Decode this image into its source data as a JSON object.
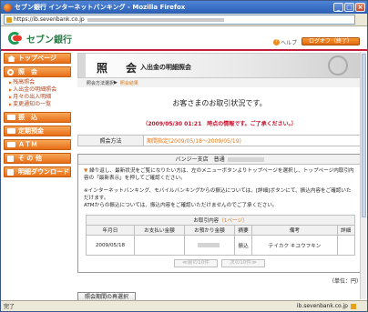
{
  "window": {
    "title": "セブン銀行 インターネットバンキング - Mozilla Firefox"
  },
  "urlbar": {
    "url": "https://ib.sevenbank.co.jp"
  },
  "header": {
    "logo_text": "セブン銀行",
    "help_label": "ヘルプ",
    "logout_label": "ログオフ（終了）"
  },
  "sidebar": {
    "top_label": "トップページ",
    "inquiry_label": "照　会",
    "sub_items": [
      "残高照会",
      "入出金の明細照会",
      "月々の出入明細",
      "変更通知の一覧"
    ],
    "transfer_label": "振　込",
    "fixed_label": "定期預金",
    "atm_label": "ＡＴＭ",
    "other_label": "そ の 他",
    "download_label": "明細ダウンロード"
  },
  "banner": {
    "title": "照　会",
    "subtitle": "入出金の明細照会"
  },
  "breadcrumb": {
    "prev": "照会方法選択",
    "current": "照会結果"
  },
  "greeting": "お客さまのお取引状況です。",
  "notice": "（2009/05/30 01:21　時点の情報です。ご了承ください。）",
  "query": {
    "method_key": "照会方法",
    "method_value": "期間指定(2009/05/18～2009/05/19)"
  },
  "account": {
    "branch": "バンジー支店　普通",
    "message_tri": "▼",
    "message": "繰り返し、最新状況をご覧になりたい方は、左のメニューボタンよりトップページを選択し、トップページ内取引内容の「最新表示」を押してご確認ください。",
    "note1": "※インターネットバンキング、モバイルバンキングからの振込については、[詳細]ボタンにて、振込内容をご確認いただけます。",
    "note2": "ATMからの振込については、振込内容をご確認いただけませんのでご了承ください。"
  },
  "transactions": {
    "caption": "お取引内容",
    "page": "（1ページ）",
    "columns": [
      "年月日",
      "お支払い金額",
      "お預かり金額",
      "摘要",
      "備考",
      "詳細"
    ],
    "rows": [
      {
        "date": "2009/05/18",
        "pay": "",
        "deposit": "",
        "summary": "振込",
        "note": "テイカク キユウフキン",
        "detail": ""
      }
    ],
    "prev_label": "≪前の10件",
    "next_label": "次の10件≫"
  },
  "unit": "（単位：円）",
  "reselect_label": "照会期間の再選択",
  "status": {
    "left": "完了",
    "right": "ib.sevenbank.co.jp"
  }
}
